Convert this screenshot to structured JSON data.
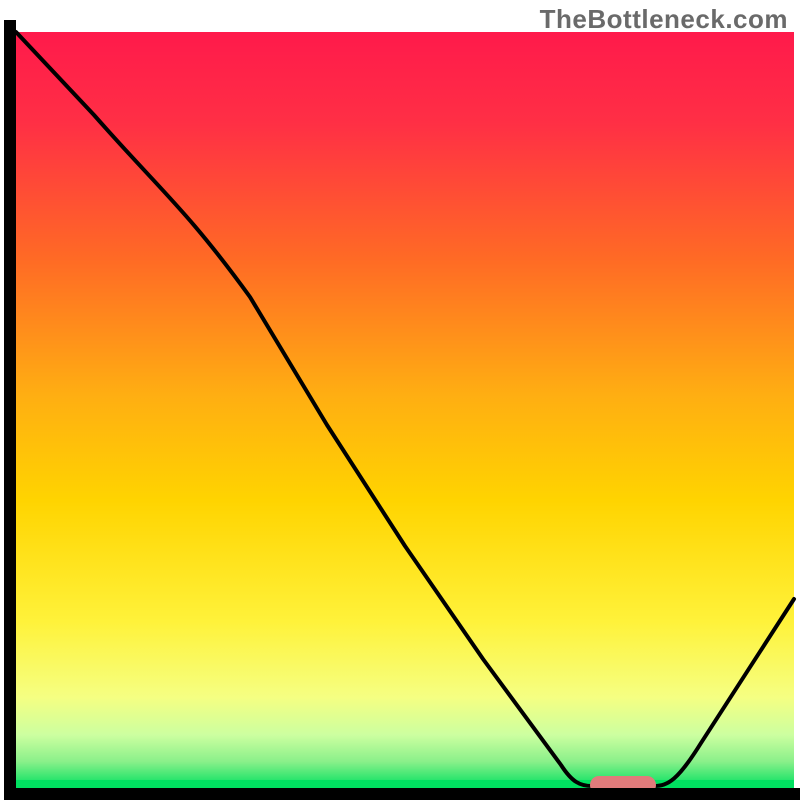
{
  "watermark": "TheBottleneck.com",
  "chart_data": {
    "type": "line",
    "title": "",
    "xlabel": "",
    "ylabel": "",
    "xlim": [
      0,
      100
    ],
    "ylim": [
      0,
      100
    ],
    "grid": false,
    "legend": false,
    "series": [
      {
        "name": "curve",
        "x": [
          0,
          10,
          22,
          30,
          40,
          50,
          60,
          70,
          74,
          82,
          88,
          100
        ],
        "values": [
          100,
          89,
          76,
          65,
          48,
          32,
          17,
          3,
          0,
          0,
          6,
          25
        ]
      }
    ],
    "marker": {
      "x_start": 74,
      "x_end": 82,
      "y": 0,
      "color": "#e17b7b"
    },
    "annotations": []
  },
  "colors": {
    "axis": "#000000",
    "curve": "#000000",
    "marker": "#e17b7b",
    "gradient": {
      "top": "#ff1a4b",
      "upper_mid": "#ff7a1f",
      "mid": "#ffd400",
      "lower_mid": "#f8ff66",
      "lower": "#d3ffa0",
      "bottom": "#00e060"
    }
  }
}
